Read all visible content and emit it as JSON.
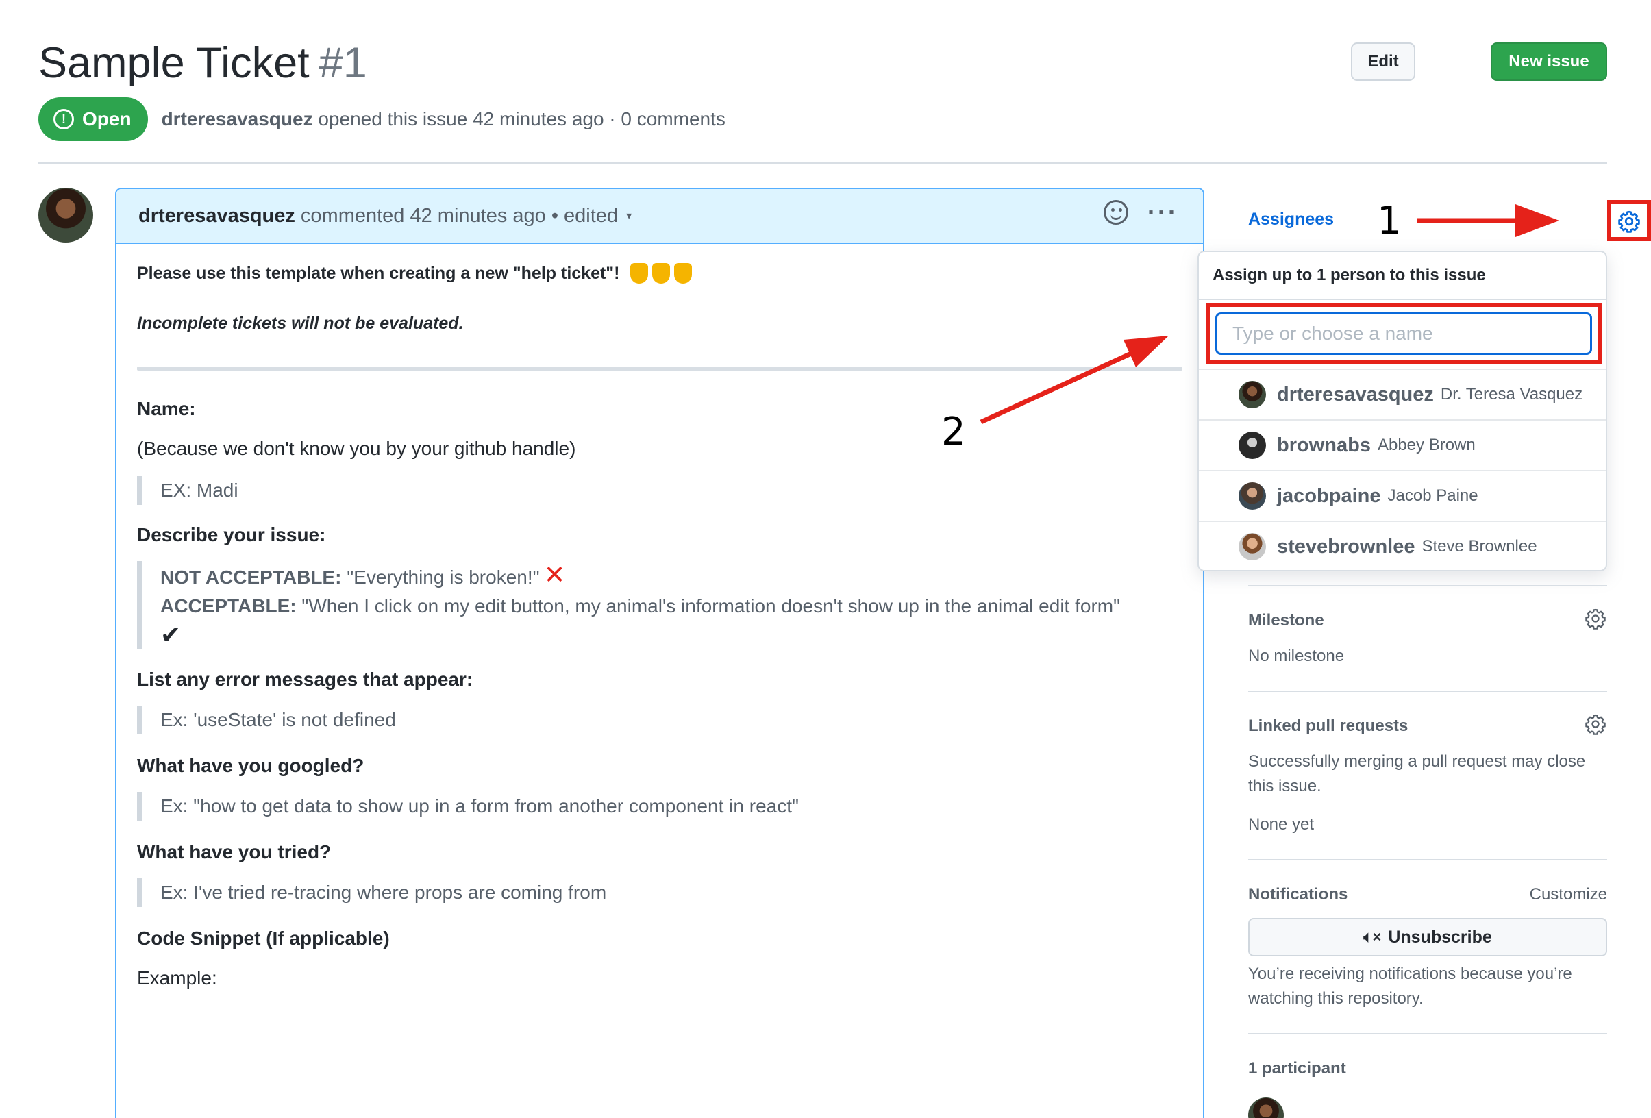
{
  "issue": {
    "title": "Sample Ticket",
    "number": "#1",
    "state": "Open",
    "author": "drteresavasquez",
    "meta": "opened this issue 42 minutes ago · 0 comments"
  },
  "header_buttons": {
    "edit": "Edit",
    "new_issue": "New issue"
  },
  "comment": {
    "author": "drteresavasquez",
    "meta": "commented 42 minutes ago • edited",
    "intro": "Please use this template when creating a new \"help ticket\"!",
    "warning": "Incomplete tickets will not be evaluated.",
    "sections": {
      "name_heading": "Name:",
      "name_desc": "(Because we don't know you by your github handle)",
      "name_example": "EX: Madi",
      "issue_heading": "Describe your issue:",
      "not_acceptable_label": "NOT ACCEPTABLE:",
      "not_acceptable_text": "\"Everything is broken!\"",
      "acceptable_label": "ACCEPTABLE:",
      "acceptable_text": "\"When I click on my edit button, my animal's information doesn't show up in the animal edit form\"",
      "errors_heading": "List any error messages that appear:",
      "errors_example": "Ex: 'useState' is not defined",
      "googled_heading": "What have you googled?",
      "googled_example": "Ex: \"how to get data to show up in a form from another component in react\"",
      "tried_heading": "What have you tried?",
      "tried_example": "Ex: I've tried re-tracing where props are coming from",
      "snippet_heading": "Code Snippet (If applicable)",
      "example_label": "Example:"
    }
  },
  "sidebar": {
    "assignees_label": "Assignees",
    "assign_dropdown": {
      "header": "Assign up to 1 person to this issue",
      "placeholder": "Type or choose a name",
      "users": [
        {
          "login": "drteresavasquez",
          "name": "Dr. Teresa Vasquez"
        },
        {
          "login": "brownabs",
          "name": "Abbey Brown"
        },
        {
          "login": "jacobpaine",
          "name": "Jacob Paine"
        },
        {
          "login": "stevebrownlee",
          "name": "Steve Brownlee"
        }
      ]
    },
    "milestone_label": "Milestone",
    "milestone_value": "No milestone",
    "linked_pr_label": "Linked pull requests",
    "linked_pr_desc": "Successfully merging a pull request may close this issue.",
    "linked_pr_value": "None yet",
    "notifications_label": "Notifications",
    "customize_label": "Customize",
    "unsubscribe_label": "Unsubscribe",
    "notifications_desc": "You’re receiving notifications because you’re watching this repository.",
    "participants_label": "1 participant"
  },
  "annotations": {
    "step1": "1",
    "step2": "2",
    "color": "#e5221a"
  },
  "icons": [
    "alert-circle-icon",
    "smiley-icon",
    "kebab-icon",
    "gear-icon",
    "mute-icon",
    "pointing-down-emoji",
    "red-x-icon",
    "checkmark-icon"
  ]
}
